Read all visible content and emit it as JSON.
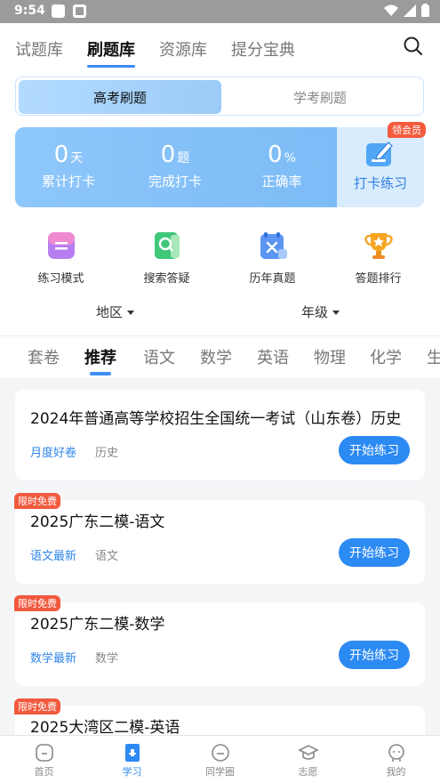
{
  "status_bar": {
    "time": "9:54"
  },
  "top_tabs": [
    {
      "label": "试题库",
      "active": false
    },
    {
      "label": "刷题库",
      "active": true
    },
    {
      "label": "资源库",
      "active": false
    },
    {
      "label": "提分宝典",
      "active": false
    }
  ],
  "segment": {
    "active": "高考刷题",
    "inactive": "学考刷题"
  },
  "stats": [
    {
      "value": "0",
      "unit": "天",
      "label": "累计打卡"
    },
    {
      "value": "0",
      "unit": "题",
      "label": "完成打卡"
    },
    {
      "value": "0",
      "unit": "%",
      "label": "正确率"
    }
  ],
  "checkin": {
    "label": "打卡练习",
    "badge": "领会员"
  },
  "tools": [
    {
      "label": "练习模式",
      "icon": "practice-mode-icon"
    },
    {
      "label": "搜索答疑",
      "icon": "search-answer-icon"
    },
    {
      "label": "历年真题",
      "icon": "past-exams-icon"
    },
    {
      "label": "答题排行",
      "icon": "ranking-trophy-icon"
    }
  ],
  "filters": {
    "region": "地区",
    "grade": "年级"
  },
  "subjects": [
    "套卷",
    "推荐",
    "语文",
    "数学",
    "英语",
    "物理",
    "化学",
    "生"
  ],
  "active_subject": "推荐",
  "cards": [
    {
      "title": "2024年普通高等学校招生全国统一考试（山东卷）历史",
      "tag": "月度好卷",
      "subject": "历史",
      "button": "开始练习",
      "badge": ""
    },
    {
      "title": "2025广东二模-语文",
      "tag": "语文最新",
      "subject": "语文",
      "button": "开始练习",
      "badge": "限时免费"
    },
    {
      "title": "2025广东二模-数学",
      "tag": "数学最新",
      "subject": "数学",
      "button": "开始练习",
      "badge": "限时免费"
    },
    {
      "title": "2025大湾区二模-英语",
      "tag": "",
      "subject": "",
      "button": "",
      "badge": "限时免费"
    }
  ],
  "bottom_nav": [
    {
      "label": "首页",
      "icon": "home-icon",
      "active": false
    },
    {
      "label": "学习",
      "icon": "study-icon",
      "active": true
    },
    {
      "label": "同学圈",
      "icon": "classmates-icon",
      "active": false
    },
    {
      "label": "志愿",
      "icon": "graduation-cap-icon",
      "active": false
    },
    {
      "label": "我的",
      "icon": "profile-icon",
      "active": false
    }
  ],
  "colors": {
    "accent": "#2c8af3",
    "badge_red": "#f15a3e",
    "stats_blue": "#8ec7fb"
  }
}
